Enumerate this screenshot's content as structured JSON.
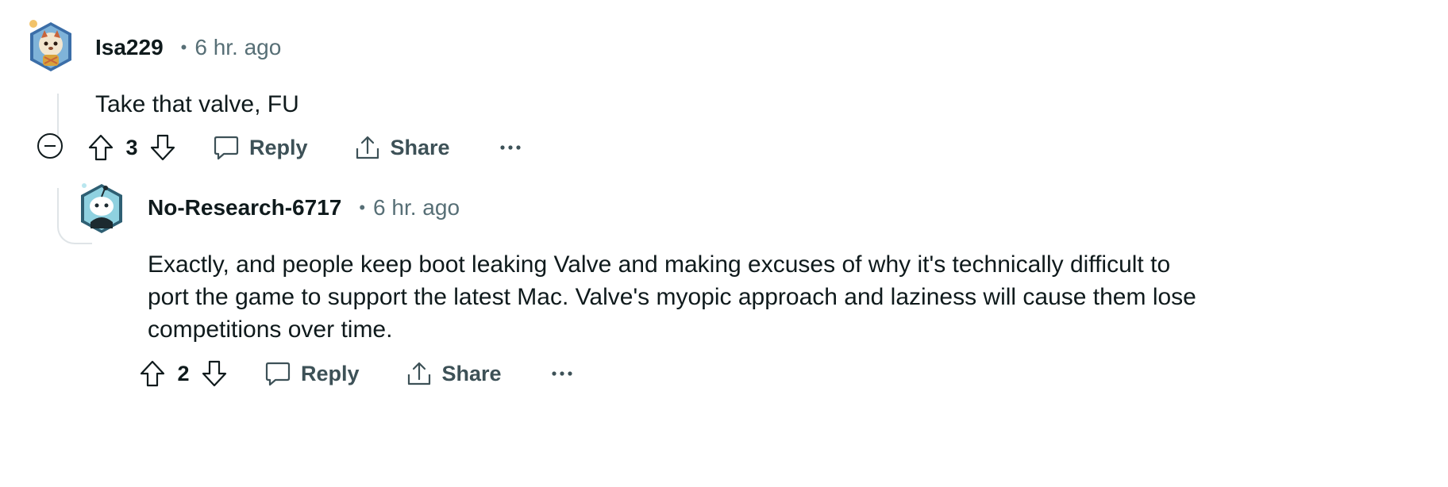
{
  "comments": [
    {
      "username": "Isa229",
      "separator": "•",
      "time": "6 hr. ago",
      "body": "Take that valve, FU",
      "score": "3",
      "reply_label": "Reply",
      "share_label": "Share",
      "more_label": "···"
    },
    {
      "username": "No-Research-6717",
      "separator": "•",
      "time": "6 hr. ago",
      "body_lines": [
        "Exactly, and people keep boot leaking Valve and making excuses of why it's technically difficult to",
        "port the game to support the latest Mac. Valve's myopic approach and laziness will cause them lose",
        "competitions over time."
      ],
      "score": "2",
      "reply_label": "Reply",
      "share_label": "Share",
      "more_label": "···"
    }
  ],
  "icons": {
    "collapse": "minus-circle-icon",
    "upvote": "arrow-up-icon",
    "downvote": "arrow-down-icon",
    "reply": "speech-bubble-icon",
    "share": "share-icon",
    "more": "overflow-icon"
  },
  "colors": {
    "text": "#0f1a1c",
    "meta": "#576f76",
    "action": "#3d5157",
    "thread": "#dfe4e7"
  }
}
